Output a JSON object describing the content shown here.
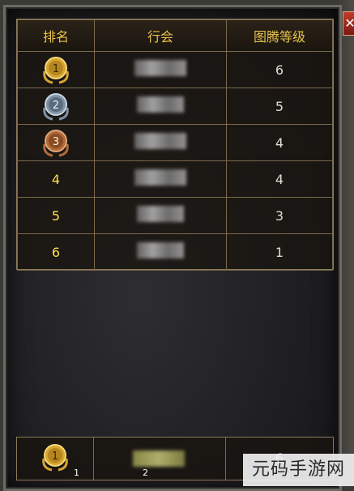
{
  "table": {
    "headers": {
      "rank": "排名",
      "guild": "行会",
      "level": "图腾等级"
    },
    "rows": [
      {
        "rank": "1",
        "medal": "gold",
        "level": "6"
      },
      {
        "rank": "2",
        "medal": "silver",
        "level": "5"
      },
      {
        "rank": "3",
        "medal": "bronze",
        "level": "4"
      },
      {
        "rank": "4",
        "medal": null,
        "level": "4"
      },
      {
        "rank": "5",
        "medal": null,
        "level": "3"
      },
      {
        "rank": "6",
        "medal": null,
        "level": "1"
      }
    ]
  },
  "own_row": {
    "rank": "1",
    "medal": "gold",
    "level": "6",
    "num_left": "1",
    "num_mid": "2"
  },
  "close_label": "✕",
  "watermark": "元码手游网",
  "colors": {
    "header_text": "#e8c24a",
    "gold": "#d6a530",
    "silver": "#7f93a8",
    "bronze": "#b06a3a"
  }
}
